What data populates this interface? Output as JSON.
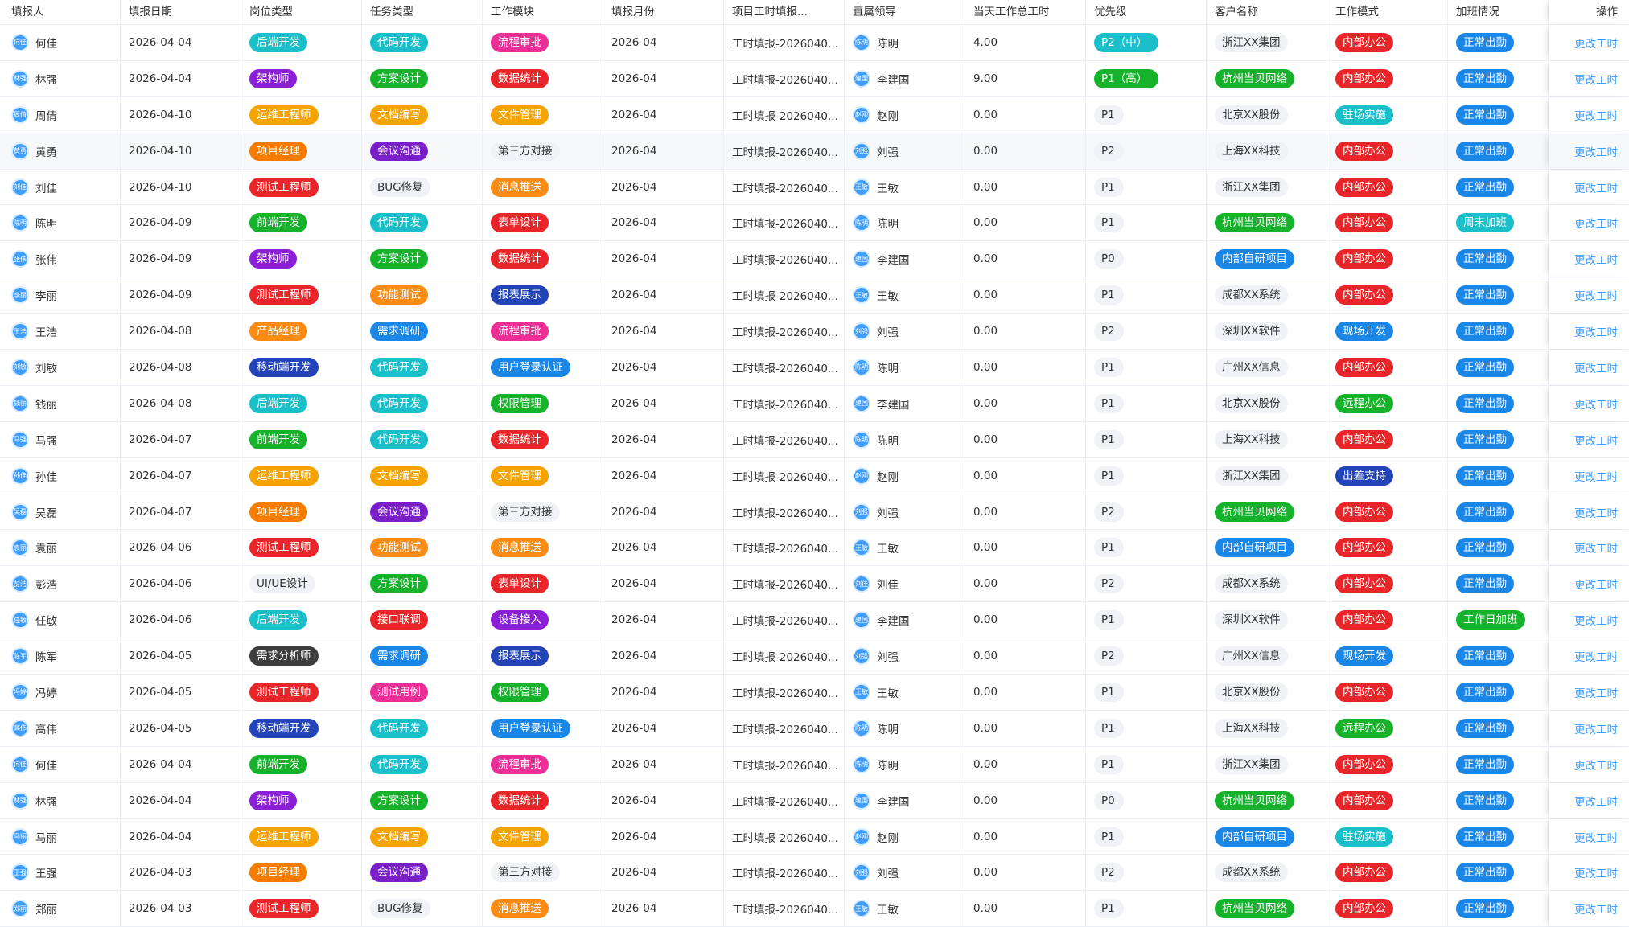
{
  "headers": [
    "填报人",
    "填报日期",
    "岗位类型",
    "任务类型",
    "工作模块",
    "填报月份",
    "项目工时填报...",
    "直属领导",
    "当天工作总工时",
    "优先级",
    "客户名称",
    "工作模式",
    "加班情况",
    "操作"
  ],
  "action_label": "更改工时",
  "colors": {
    "后端开发": "#1bbfc9",
    "架构师": "#8a1fd6",
    "运维工程师": "#f5a300",
    "项目经理": "#f57c00",
    "测试工程师": "#e8262a",
    "前端开发": "#16b22b",
    "产品经理": "#fa8c16",
    "移动端开发": "#2244b8",
    "需求分析师": "#3d3d3d",
    "UI/UE设计": "plain",
    "代码开发": "#1bbfc9",
    "方案设计": "#16b22b",
    "文档编写": "#f5a300",
    "会议沟通": "#7a1fc8",
    "BUG修复": "plain",
    "功能测试": "#fa8c16",
    "需求调研": "#1a86e6",
    "接口联调": "#e8262a",
    "测试用例": "#eb2f96",
    "流程审批": "#eb2f96",
    "数据统计": "#e8262a",
    "文件管理": "#f5a300",
    "第三方对接": "plain",
    "消息推送": "#fa8c16",
    "表单设计": "#e8262a",
    "报表展示": "#2244b8",
    "用户登录认证": "#1a86e6",
    "权限管理": "#16b22b",
    "设备接入": "#8a1fd6",
    "浙江XX集团": "plain",
    "杭州当贝网络": "#16b22b",
    "北京XX股份": "plain",
    "上海XX科技": "plain",
    "内部自研项目": "#1a86e6",
    "成都XX系统": "plain",
    "深圳XX软件": "plain",
    "广州XX信息": "plain",
    "内部办公": "#e8262a",
    "驻场实施": "#1bbfc9",
    "现场开发": "#1a86e6",
    "远程办公": "#16b22b",
    "出差支持": "#2244b8",
    "正常出勤": "#1a86e6",
    "周末加班": "#1bbfc9",
    "工作日加班": "#16b22b",
    "P2（中）": "#1bbfc9",
    "P1（高）": "#16b22b"
  },
  "rows": [
    {
      "reporter": "何佳",
      "av": "何佳",
      "date": "2026-04-04",
      "role": "后端开发",
      "task": "代码开发",
      "module": "流程审批",
      "month": "2026-04",
      "project": "工时填报-2026040...",
      "lead": "陈明",
      "lav": "陈明",
      "hours": "4.00",
      "priority": "P2（中）",
      "client": "浙江XX集团",
      "mode": "内部办公",
      "ot": "正常出勤"
    },
    {
      "reporter": "林强",
      "av": "林强",
      "date": "2026-04-04",
      "role": "架构师",
      "task": "方案设计",
      "module": "数据统计",
      "month": "2026-04",
      "project": "工时填报-2026040...",
      "lead": "李建国",
      "lav": "建国",
      "hours": "9.00",
      "priority": "P1（高）",
      "client": "杭州当贝网络",
      "mode": "内部办公",
      "ot": "正常出勤"
    },
    {
      "reporter": "周倩",
      "av": "周倩",
      "date": "2026-04-10",
      "role": "运维工程师",
      "task": "文档编写",
      "module": "文件管理",
      "month": "2026-04",
      "project": "工时填报-2026040...",
      "lead": "赵刚",
      "lav": "赵刚",
      "hours": "0.00",
      "priority": "P1",
      "client": "北京XX股份",
      "mode": "驻场实施",
      "ot": "正常出勤"
    },
    {
      "reporter": "黄勇",
      "av": "黄勇",
      "date": "2026-04-10",
      "role": "项目经理",
      "task": "会议沟通",
      "module": "第三方对接",
      "month": "2026-04",
      "project": "工时填报-2026040...",
      "lead": "刘强",
      "lav": "刘强",
      "hours": "0.00",
      "priority": "P2",
      "client": "上海XX科技",
      "mode": "内部办公",
      "ot": "正常出勤"
    },
    {
      "reporter": "刘佳",
      "av": "刘佳",
      "date": "2026-04-10",
      "role": "测试工程师",
      "task": "BUG修复",
      "module": "消息推送",
      "month": "2026-04",
      "project": "工时填报-2026040...",
      "lead": "王敏",
      "lav": "王敏",
      "hours": "0.00",
      "priority": "P1",
      "client": "浙江XX集团",
      "mode": "内部办公",
      "ot": "正常出勤"
    },
    {
      "reporter": "陈明",
      "av": "陈明",
      "date": "2026-04-09",
      "role": "前端开发",
      "task": "代码开发",
      "module": "表单设计",
      "month": "2026-04",
      "project": "工时填报-2026040...",
      "lead": "陈明",
      "lav": "陈明",
      "hours": "0.00",
      "priority": "P1",
      "client": "杭州当贝网络",
      "mode": "内部办公",
      "ot": "周末加班"
    },
    {
      "reporter": "张伟",
      "av": "张伟",
      "date": "2026-04-09",
      "role": "架构师",
      "task": "方案设计",
      "module": "数据统计",
      "month": "2026-04",
      "project": "工时填报-2026040...",
      "lead": "李建国",
      "lav": "建国",
      "hours": "0.00",
      "priority": "P0",
      "client": "内部自研项目",
      "mode": "内部办公",
      "ot": "正常出勤"
    },
    {
      "reporter": "李丽",
      "av": "李丽",
      "date": "2026-04-09",
      "role": "测试工程师",
      "task": "功能测试",
      "module": "报表展示",
      "month": "2026-04",
      "project": "工时填报-2026040...",
      "lead": "王敏",
      "lav": "王敏",
      "hours": "0.00",
      "priority": "P1",
      "client": "成都XX系统",
      "mode": "内部办公",
      "ot": "正常出勤"
    },
    {
      "reporter": "王浩",
      "av": "王浩",
      "date": "2026-04-08",
      "role": "产品经理",
      "task": "需求调研",
      "module": "流程审批",
      "month": "2026-04",
      "project": "工时填报-2026040...",
      "lead": "刘强",
      "lav": "刘强",
      "hours": "0.00",
      "priority": "P2",
      "client": "深圳XX软件",
      "mode": "现场开发",
      "ot": "正常出勤"
    },
    {
      "reporter": "刘敏",
      "av": "刘敏",
      "date": "2026-04-08",
      "role": "移动端开发",
      "task": "代码开发",
      "module": "用户登录认证",
      "month": "2026-04",
      "project": "工时填报-2026040...",
      "lead": "陈明",
      "lav": "陈明",
      "hours": "0.00",
      "priority": "P1",
      "client": "广州XX信息",
      "mode": "内部办公",
      "ot": "正常出勤"
    },
    {
      "reporter": "钱丽",
      "av": "钱丽",
      "date": "2026-04-08",
      "role": "后端开发",
      "task": "代码开发",
      "module": "权限管理",
      "month": "2026-04",
      "project": "工时填报-2026040...",
      "lead": "李建国",
      "lav": "建国",
      "hours": "0.00",
      "priority": "P1",
      "client": "北京XX股份",
      "mode": "远程办公",
      "ot": "正常出勤"
    },
    {
      "reporter": "马强",
      "av": "马强",
      "date": "2026-04-07",
      "role": "前端开发",
      "task": "代码开发",
      "module": "数据统计",
      "month": "2026-04",
      "project": "工时填报-2026040...",
      "lead": "陈明",
      "lav": "陈明",
      "hours": "0.00",
      "priority": "P1",
      "client": "上海XX科技",
      "mode": "内部办公",
      "ot": "正常出勤"
    },
    {
      "reporter": "孙佳",
      "av": "孙佳",
      "date": "2026-04-07",
      "role": "运维工程师",
      "task": "文档编写",
      "module": "文件管理",
      "month": "2026-04",
      "project": "工时填报-2026040...",
      "lead": "赵刚",
      "lav": "赵刚",
      "hours": "0.00",
      "priority": "P1",
      "client": "浙江XX集团",
      "mode": "出差支持",
      "ot": "正常出勤"
    },
    {
      "reporter": "吴磊",
      "av": "吴磊",
      "date": "2026-04-07",
      "role": "项目经理",
      "task": "会议沟通",
      "module": "第三方对接",
      "month": "2026-04",
      "project": "工时填报-2026040...",
      "lead": "刘强",
      "lav": "刘强",
      "hours": "0.00",
      "priority": "P2",
      "client": "杭州当贝网络",
      "mode": "内部办公",
      "ot": "正常出勤"
    },
    {
      "reporter": "袁丽",
      "av": "袁丽",
      "date": "2026-04-06",
      "role": "测试工程师",
      "task": "功能测试",
      "module": "消息推送",
      "month": "2026-04",
      "project": "工时填报-2026040...",
      "lead": "王敏",
      "lav": "王敏",
      "hours": "0.00",
      "priority": "P1",
      "client": "内部自研项目",
      "mode": "内部办公",
      "ot": "正常出勤"
    },
    {
      "reporter": "彭浩",
      "av": "彭浩",
      "date": "2026-04-06",
      "role": "UI/UE设计",
      "task": "方案设计",
      "module": "表单设计",
      "month": "2026-04",
      "project": "工时填报-2026040...",
      "lead": "刘佳",
      "lav": "刘佳",
      "hours": "0.00",
      "priority": "P2",
      "client": "成都XX系统",
      "mode": "内部办公",
      "ot": "正常出勤"
    },
    {
      "reporter": "任敏",
      "av": "任敏",
      "date": "2026-04-06",
      "role": "后端开发",
      "task": "接口联调",
      "module": "设备接入",
      "month": "2026-04",
      "project": "工时填报-2026040...",
      "lead": "李建国",
      "lav": "建国",
      "hours": "0.00",
      "priority": "P1",
      "client": "深圳XX软件",
      "mode": "内部办公",
      "ot": "工作日加班"
    },
    {
      "reporter": "陈军",
      "av": "陈军",
      "date": "2026-04-05",
      "role": "需求分析师",
      "task": "需求调研",
      "module": "报表展示",
      "month": "2026-04",
      "project": "工时填报-2026040...",
      "lead": "刘强",
      "lav": "刘强",
      "hours": "0.00",
      "priority": "P2",
      "client": "广州XX信息",
      "mode": "现场开发",
      "ot": "正常出勤"
    },
    {
      "reporter": "冯婷",
      "av": "冯婷",
      "date": "2026-04-05",
      "role": "测试工程师",
      "task": "测试用例",
      "module": "权限管理",
      "month": "2026-04",
      "project": "工时填报-2026040...",
      "lead": "王敏",
      "lav": "王敏",
      "hours": "0.00",
      "priority": "P1",
      "client": "北京XX股份",
      "mode": "内部办公",
      "ot": "正常出勤"
    },
    {
      "reporter": "高伟",
      "av": "高伟",
      "date": "2026-04-05",
      "role": "移动端开发",
      "task": "代码开发",
      "module": "用户登录认证",
      "month": "2026-04",
      "project": "工时填报-2026040...",
      "lead": "陈明",
      "lav": "陈明",
      "hours": "0.00",
      "priority": "P1",
      "client": "上海XX科技",
      "mode": "远程办公",
      "ot": "正常出勤"
    },
    {
      "reporter": "何佳",
      "av": "何佳",
      "date": "2026-04-04",
      "role": "前端开发",
      "task": "代码开发",
      "module": "流程审批",
      "month": "2026-04",
      "project": "工时填报-2026040...",
      "lead": "陈明",
      "lav": "陈明",
      "hours": "0.00",
      "priority": "P1",
      "client": "浙江XX集团",
      "mode": "内部办公",
      "ot": "正常出勤"
    },
    {
      "reporter": "林强",
      "av": "林强",
      "date": "2026-04-04",
      "role": "架构师",
      "task": "方案设计",
      "module": "数据统计",
      "month": "2026-04",
      "project": "工时填报-2026040...",
      "lead": "李建国",
      "lav": "建国",
      "hours": "0.00",
      "priority": "P0",
      "client": "杭州当贝网络",
      "mode": "内部办公",
      "ot": "正常出勤"
    },
    {
      "reporter": "马丽",
      "av": "马丽",
      "date": "2026-04-04",
      "role": "运维工程师",
      "task": "文档编写",
      "module": "文件管理",
      "month": "2026-04",
      "project": "工时填报-2026040...",
      "lead": "赵刚",
      "lav": "赵刚",
      "hours": "0.00",
      "priority": "P1",
      "client": "内部自研项目",
      "mode": "驻场实施",
      "ot": "正常出勤"
    },
    {
      "reporter": "王强",
      "av": "王强",
      "date": "2026-04-03",
      "role": "项目经理",
      "task": "会议沟通",
      "module": "第三方对接",
      "month": "2026-04",
      "project": "工时填报-2026040...",
      "lead": "刘强",
      "lav": "刘强",
      "hours": "0.00",
      "priority": "P2",
      "client": "成都XX系统",
      "mode": "内部办公",
      "ot": "正常出勤"
    },
    {
      "reporter": "郑丽",
      "av": "郑丽",
      "date": "2026-04-03",
      "role": "测试工程师",
      "task": "BUG修复",
      "module": "消息推送",
      "month": "2026-04",
      "project": "工时填报-2026040...",
      "lead": "王敏",
      "lav": "王敏",
      "hours": "0.00",
      "priority": "P1",
      "client": "杭州当贝网络",
      "mode": "内部办公",
      "ot": "正常出勤"
    }
  ]
}
